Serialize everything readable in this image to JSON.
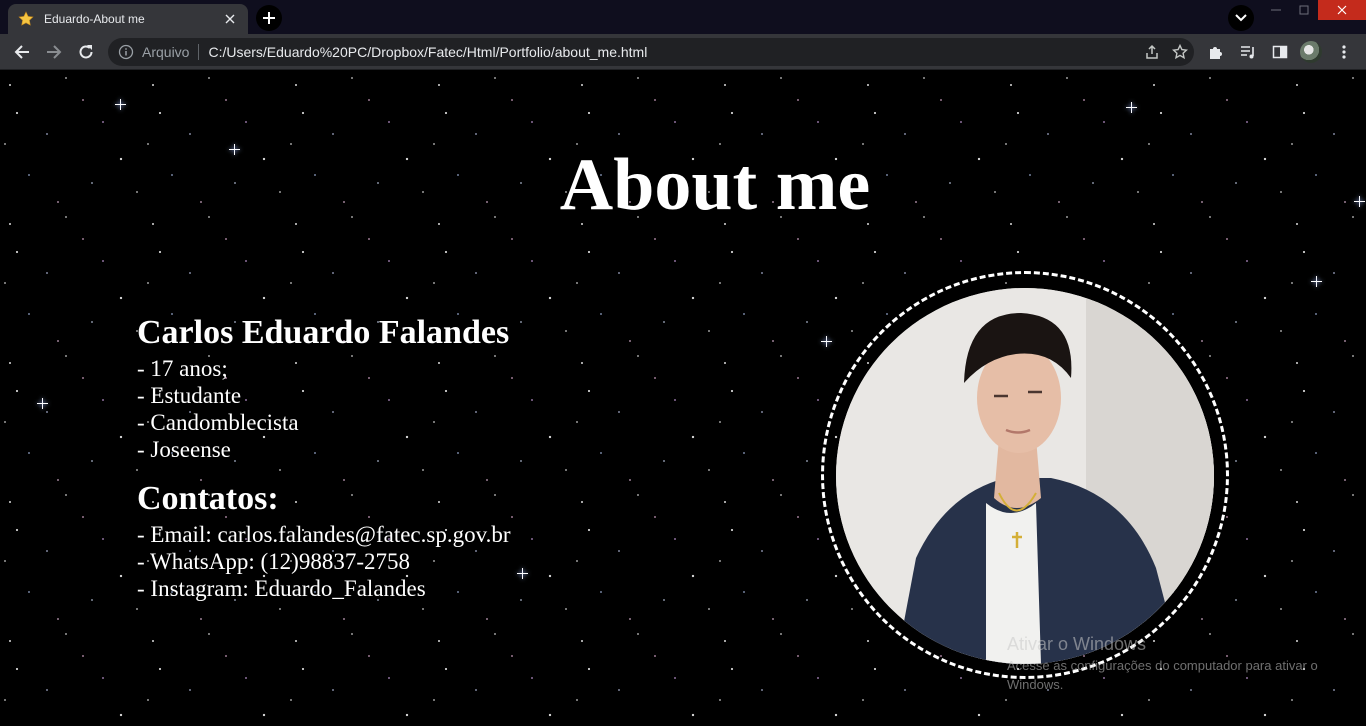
{
  "browser": {
    "tab_title": "Eduardo-About me",
    "omnibox_scheme": "Arquivo",
    "url": "C:/Users/Eduardo%20PC/Dropbox/Fatec/Html/Portfolio/about_me.html"
  },
  "page": {
    "title": "About me",
    "name": "Carlos Eduardo Falandes",
    "bio": [
      "- 17 anos;",
      "- Estudante",
      "- Candomblecista",
      "- Joseense"
    ],
    "contacts_title": "Contatos:",
    "contacts": [
      "- Email: carlos.falandes@fatec.sp.gov.br",
      "- WhatsApp: (12)98837-2758",
      "- Instagram: Eduardo_Falandes"
    ]
  },
  "watermark": {
    "title": "Ativar o Windows",
    "subtitle": "Acesse as configurações do computador para ativar o Windows."
  },
  "colors": {
    "background": "#000000",
    "text": "#ffffff",
    "chrome_toolbar": "#35363a",
    "title_bar": "#0f0e1e",
    "close_button": "#c42b1c"
  }
}
